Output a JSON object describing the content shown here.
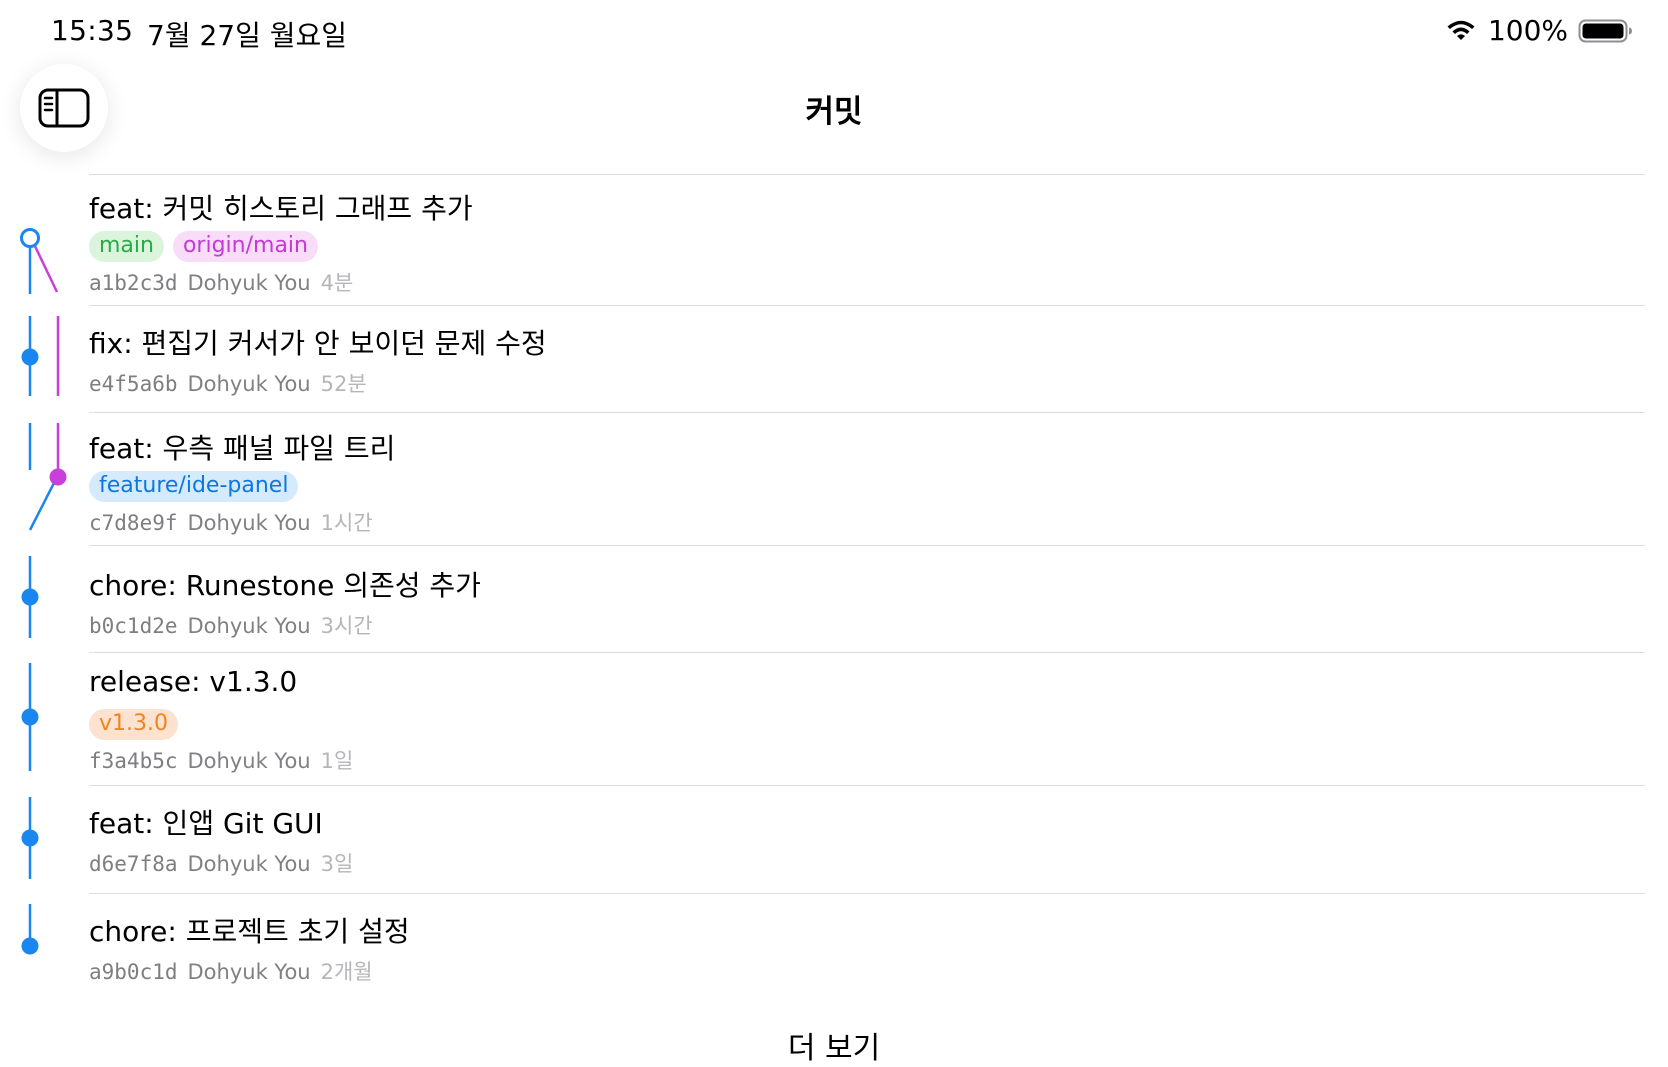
{
  "status_bar": {
    "time": "15:35",
    "date": "7월 27일 월요일",
    "battery": "100%"
  },
  "nav": {
    "title": "커밋"
  },
  "colors": {
    "graph_blue": "#1a86f0",
    "graph_magenta": "#c93fdb"
  },
  "commits": [
    {
      "message": "feat: 커밋 히스토리 그래프 추가",
      "hash": "a1b2c3d",
      "author": "Dohyuk You",
      "time": "4분",
      "tags": [
        {
          "label": "main",
          "color": "green"
        },
        {
          "label": "origin/main",
          "color": "magenta"
        }
      ]
    },
    {
      "message": "fix: 편집기 커서가 안 보이던 문제 수정",
      "hash": "e4f5a6b",
      "author": "Dohyuk You",
      "time": "52분",
      "tags": []
    },
    {
      "message": "feat: 우측 패널 파일 트리",
      "hash": "c7d8e9f",
      "author": "Dohyuk You",
      "time": "1시간",
      "tags": [
        {
          "label": "feature/ide-panel",
          "color": "blue"
        }
      ]
    },
    {
      "message": "chore: Runestone 의존성 추가",
      "hash": "b0c1d2e",
      "author": "Dohyuk You",
      "time": "3시간",
      "tags": []
    },
    {
      "message": "release: v1.3.0",
      "hash": "f3a4b5c",
      "author": "Dohyuk You",
      "time": "1일",
      "tags": [
        {
          "label": "v1.3.0",
          "color": "orange"
        }
      ]
    },
    {
      "message": "feat: 인앱 Git GUI",
      "hash": "d6e7f8a",
      "author": "Dohyuk You",
      "time": "3일",
      "tags": []
    },
    {
      "message": "chore: 프로젝트 초기 설정",
      "hash": "a9b0c1d",
      "author": "Dohyuk You",
      "time": "2개월",
      "tags": []
    }
  ],
  "load_more": "더 보기"
}
